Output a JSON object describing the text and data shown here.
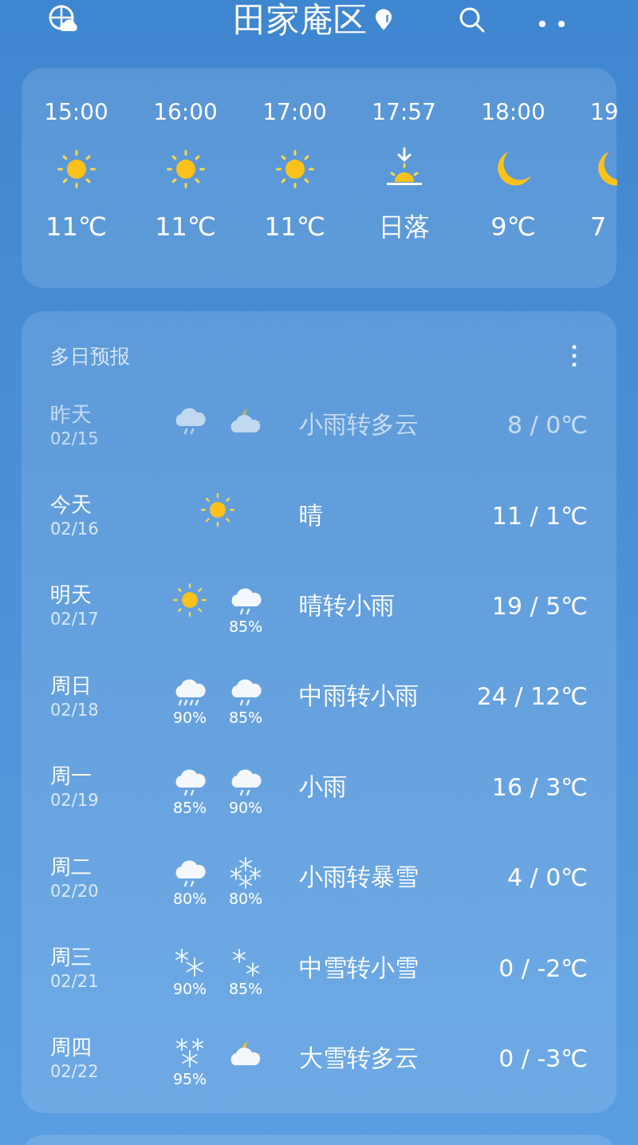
{
  "header": {
    "title": "田家庵区"
  },
  "hourly": [
    {
      "time": "15:00",
      "kind": "sun",
      "value": "11℃"
    },
    {
      "time": "16:00",
      "kind": "sun",
      "value": "11℃"
    },
    {
      "time": "17:00",
      "kind": "sun",
      "value": "11℃"
    },
    {
      "time": "17:57",
      "kind": "sunset",
      "value": "日落"
    },
    {
      "time": "18:00",
      "kind": "moon",
      "value": "9℃"
    },
    {
      "time": "19",
      "kind": "moon",
      "value": "7"
    }
  ],
  "forecast": {
    "title": "多日预报",
    "days": [
      {
        "day": "昨天",
        "date": "02/15",
        "past": true,
        "icons": [
          {
            "kind": "light-rain"
          },
          {
            "kind": "cloudy-night"
          }
        ],
        "condition": "小雨转多云",
        "temp": "8 / 0℃"
      },
      {
        "day": "今天",
        "date": "02/16",
        "past": false,
        "icons": [
          {
            "kind": "sun"
          }
        ],
        "condition": "晴",
        "temp": "11 / 1℃"
      },
      {
        "day": "明天",
        "date": "02/17",
        "past": false,
        "icons": [
          {
            "kind": "sun"
          },
          {
            "kind": "light-rain",
            "chance": "85%"
          }
        ],
        "condition": "晴转小雨",
        "temp": "19 / 5℃"
      },
      {
        "day": "周日",
        "date": "02/18",
        "past": false,
        "icons": [
          {
            "kind": "moderate-rain",
            "chance": "90%"
          },
          {
            "kind": "light-rain",
            "chance": "85%"
          }
        ],
        "condition": "中雨转小雨",
        "temp": "24 / 12℃"
      },
      {
        "day": "周一",
        "date": "02/19",
        "past": false,
        "icons": [
          {
            "kind": "light-rain",
            "chance": "85%"
          },
          {
            "kind": "light-rain",
            "chance": "90%"
          }
        ],
        "condition": "小雨",
        "temp": "16 / 3℃"
      },
      {
        "day": "周二",
        "date": "02/20",
        "past": false,
        "icons": [
          {
            "kind": "light-rain",
            "chance": "80%"
          },
          {
            "kind": "blizzard",
            "chance": "80%"
          }
        ],
        "condition": "小雨转暴雪",
        "temp": "4 / 0℃"
      },
      {
        "day": "周三",
        "date": "02/21",
        "past": false,
        "icons": [
          {
            "kind": "moderate-snow",
            "chance": "90%"
          },
          {
            "kind": "light-snow",
            "chance": "85%"
          }
        ],
        "condition": "中雪转小雪",
        "temp": "0 / -2℃"
      },
      {
        "day": "周四",
        "date": "02/22",
        "past": false,
        "icons": [
          {
            "kind": "heavy-snow",
            "chance": "95%"
          },
          {
            "kind": "cloudy-night"
          }
        ],
        "condition": "大雪转多云",
        "temp": "0 / -3℃"
      }
    ]
  }
}
